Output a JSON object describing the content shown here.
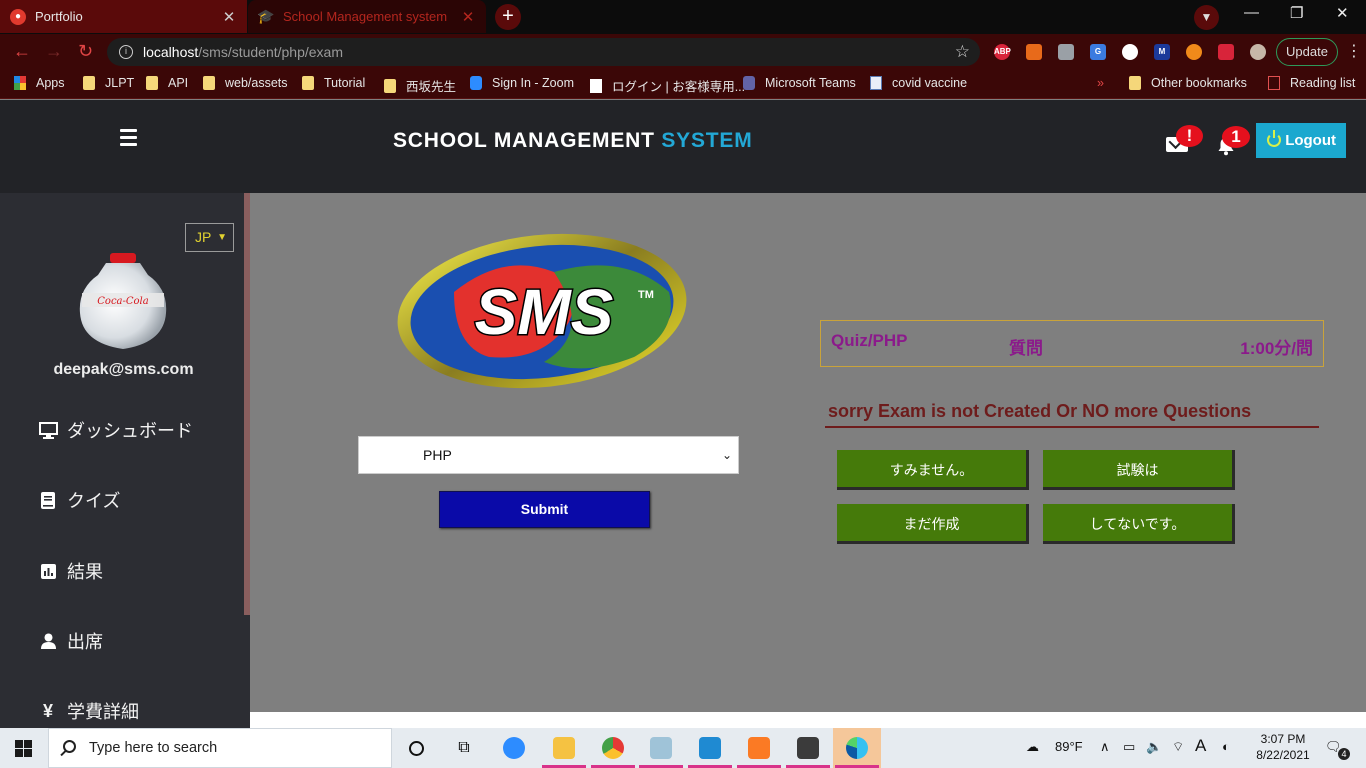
{
  "browser": {
    "tabs": [
      {
        "title": "Portfolio",
        "active": false
      },
      {
        "title": "School Management system",
        "active": true
      }
    ],
    "url_host": "localhost",
    "url_path": "/sms/student/php/exam",
    "update_label": "Update",
    "bookmarks": [
      {
        "label": "Apps",
        "icon": "apps-grid-icon"
      },
      {
        "label": "JLPT",
        "icon": "folder-icon"
      },
      {
        "label": "API",
        "icon": "folder-icon"
      },
      {
        "label": "web/assets",
        "icon": "folder-icon"
      },
      {
        "label": "Tutorial",
        "icon": "folder-icon"
      },
      {
        "label": "西坂先生",
        "icon": "folder-icon"
      },
      {
        "label": "Sign In - Zoom",
        "icon": "zoom-icon"
      },
      {
        "label": "ログイン | お客様専用...",
        "icon": "page-icon"
      },
      {
        "label": "Microsoft Teams",
        "icon": "teams-icon"
      },
      {
        "label": "covid vaccine",
        "icon": "covid-icon"
      }
    ],
    "more_bookmarks": "»",
    "other_bookmarks": "Other bookmarks",
    "reading_list": "Reading list"
  },
  "header": {
    "title_main": "SCHOOL MANAGEMENT ",
    "title_accent": "SYSTEM",
    "mail_badge": "!",
    "notification_count": "1",
    "logout_label": "Logout",
    "accent_color": "#23a8d6"
  },
  "sidebar": {
    "language": "JP",
    "user_email": "deepak@sms.com",
    "items": [
      {
        "label": "ダッシュボード",
        "icon": "monitor-icon"
      },
      {
        "label": "クイズ",
        "icon": "book-icon"
      },
      {
        "label": "結果",
        "icon": "bar-chart-icon"
      },
      {
        "label": "出席",
        "icon": "user-icon"
      },
      {
        "label": "学費詳細",
        "icon": "yen-icon",
        "glyph": "¥"
      }
    ]
  },
  "main": {
    "logo_text": "SMS",
    "logo_tm": "TM",
    "subject_selected": "PHP",
    "submit_label": "Submit",
    "quiz": {
      "title": "Quiz/PHP",
      "question_label": "質問",
      "time_label": "1:00分/問"
    },
    "message": "sorry Exam is not Created Or NO more Questions",
    "answers": [
      "すみません。",
      "試験は",
      "まだ作成",
      "してないです。"
    ]
  },
  "taskbar": {
    "search_placeholder": "Type here to search",
    "weather": "89°F",
    "ime": "A",
    "time": "3:07 PM",
    "date": "8/22/2021",
    "notification_count": "4"
  }
}
